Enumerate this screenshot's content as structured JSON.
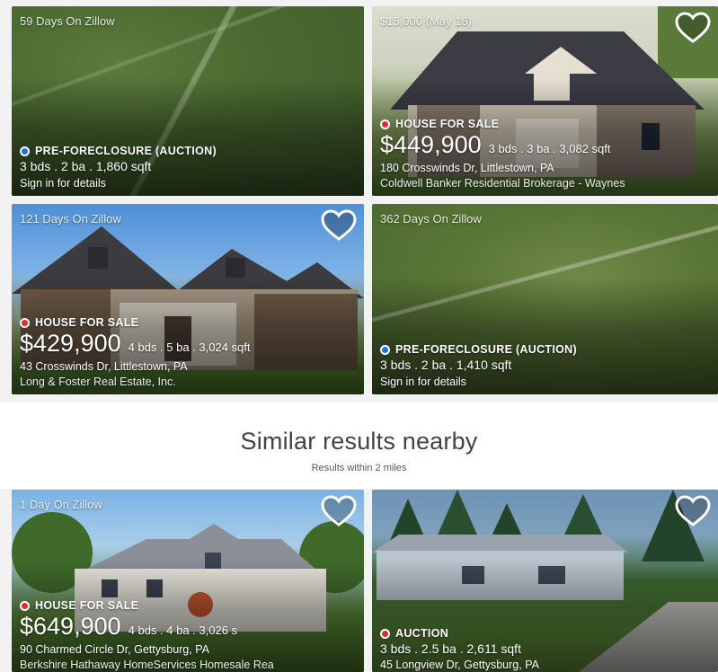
{
  "cards": [
    {
      "days": "59 Days On Zillow",
      "status": "PRE-FORECLOSURE (AUCTION)",
      "status_color": "#1e6ee8",
      "specs": "3 bds . 2 ba . 1,860 sqft",
      "signin": "Sign in for details"
    },
    {
      "days": "$15,000 (May 18)",
      "status": "HOUSE FOR SALE",
      "status_color": "#e02b2b",
      "price": "$449,900",
      "specs": "3 bds . 3 ba . 3,082 sqft",
      "address": "180 Crosswinds Dr, Littlestown, PA",
      "broker": "Coldwell Banker Residential Brokerage - Waynes"
    },
    {
      "days": "121 Days On Zillow",
      "status": "HOUSE FOR SALE",
      "status_color": "#e02b2b",
      "price": "$429,900",
      "specs": "4 bds . 5 ba . 3,024 sqft",
      "address": "43 Crosswinds Dr, Littlestown, PA",
      "broker": "Long & Foster Real Estate, Inc."
    },
    {
      "days": "362 Days On Zillow",
      "status": "PRE-FORECLOSURE (AUCTION)",
      "status_color": "#1e6ee8",
      "specs": "3 bds . 2 ba . 1,410 sqft",
      "signin": "Sign in for details"
    },
    {
      "days": "1 Day On Zillow",
      "status": "HOUSE FOR SALE",
      "status_color": "#e02b2b",
      "price": "$649,900",
      "specs": "4 bds . 4 ba . 3,026 s",
      "address": "90 Charmed Circle Dr, Gettysburg, PA",
      "broker": "Berkshire Hathaway HomeServices Homesale Rea"
    },
    {
      "status": "AUCTION",
      "status_color": "#e02b2b",
      "specs": "3 bds . 2.5 ba . 2,611 sqft",
      "address": "45 Longview Dr, Gettysburg, PA"
    }
  ],
  "similar": {
    "title": "Similar results nearby",
    "subtitle": "Results within 2 miles"
  },
  "icons": {
    "favorite": "heart-outline-icon",
    "status": "status-dot-icon"
  }
}
